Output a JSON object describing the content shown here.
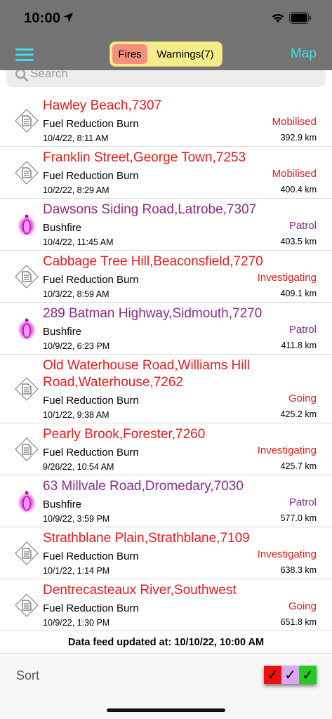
{
  "status_bar": {
    "time": "10:00"
  },
  "nav": {
    "tabs": [
      {
        "label": "Fires",
        "selected": true
      },
      {
        "label": "Warnings(7)",
        "selected": false
      }
    ],
    "map_label": "Map"
  },
  "colors": {
    "fires_tab": "#f4907b",
    "segment_bg": "#f3ec8a",
    "map_link": "#3de0ea",
    "fuel_reduction": "#ee1a1a",
    "bushfire": "#8e2a8e"
  },
  "search": {
    "placeholder": "Search"
  },
  "incidents": [
    {
      "title": "Hawley Beach,7307",
      "type": "Fuel Reduction Burn",
      "date": "10/4/22, 8:11 AM",
      "status": "Mobilised",
      "distance": "392.9 km",
      "icon": "diamond-document-icon",
      "color": "red"
    },
    {
      "title": "Franklin Street,George Town,7253",
      "type": "Fuel Reduction Burn",
      "date": "10/2/22, 8:29 AM",
      "status": "Mobilised",
      "distance": "400.4 km",
      "icon": "diamond-document-icon",
      "color": "red"
    },
    {
      "title": "Dawsons Siding Road,Latrobe,7307",
      "type": "Bushfire",
      "date": "10/4/22, 11:45 AM",
      "status": "Patrol",
      "distance": "403.5 km",
      "icon": "bushfire-marker-icon",
      "color": "purple"
    },
    {
      "title": "Cabbage Tree Hill,Beaconsfield,7270",
      "type": "Fuel Reduction Burn",
      "date": "10/3/22, 8:59 AM",
      "status": "Investigating",
      "distance": "409.1 km",
      "icon": "diamond-document-icon",
      "color": "red"
    },
    {
      "title": "289 Batman Highway,Sidmouth,7270",
      "type": "Bushfire",
      "date": "10/9/22, 6:23 PM",
      "status": "Patrol",
      "distance": "411.8 km",
      "icon": "bushfire-marker-icon",
      "color": "purple"
    },
    {
      "title": "Old Waterhouse Road,Williams Hill Road,Waterhouse,7262",
      "type": "Fuel Reduction Burn",
      "date": "10/1/22, 9:38 AM",
      "status": "Going",
      "distance": "425.2 km",
      "icon": "diamond-document-icon",
      "color": "red",
      "tall": true
    },
    {
      "title": "Pearly Brook,Forester,7260",
      "type": "Fuel Reduction Burn",
      "date": "9/26/22, 10:54 AM",
      "status": "Investigating",
      "distance": "425.7 km",
      "icon": "diamond-document-icon",
      "color": "red"
    },
    {
      "title": "63 Millvale Road,Dromedary,7030",
      "type": "Bushfire",
      "date": "10/9/22, 3:59 PM",
      "status": "Patrol",
      "distance": "577.0 km",
      "icon": "bushfire-marker-icon",
      "color": "purple"
    },
    {
      "title": "Strathblane Plain,Strathblane,7109",
      "type": "Fuel Reduction Burn",
      "date": "10/1/22, 1:14 PM",
      "status": "Investigating",
      "distance": "638.3 km",
      "icon": "diamond-document-icon",
      "color": "red"
    },
    {
      "title": "Dentrecasteaux River,Southwest",
      "type": "Fuel Reduction Burn",
      "date": "10/9/22, 1:30 PM",
      "status": "Going",
      "distance": "651.8 km",
      "icon": "diamond-document-icon",
      "color": "red"
    }
  ],
  "footer": {
    "feed_updated": "Data feed updated at: 10/10/22, 10:00 AM",
    "sort_label": "Sort",
    "filters": [
      {
        "name": "red-filter",
        "bg": "#ee1111",
        "check": "✓",
        "check_color": "#000000"
      },
      {
        "name": "purple-filter",
        "bg": "#d9a8f0",
        "check": "✓",
        "check_color": "#000000"
      },
      {
        "name": "green-filter",
        "bg": "#22cc22",
        "check": "✓",
        "check_color": "#000000"
      }
    ]
  }
}
